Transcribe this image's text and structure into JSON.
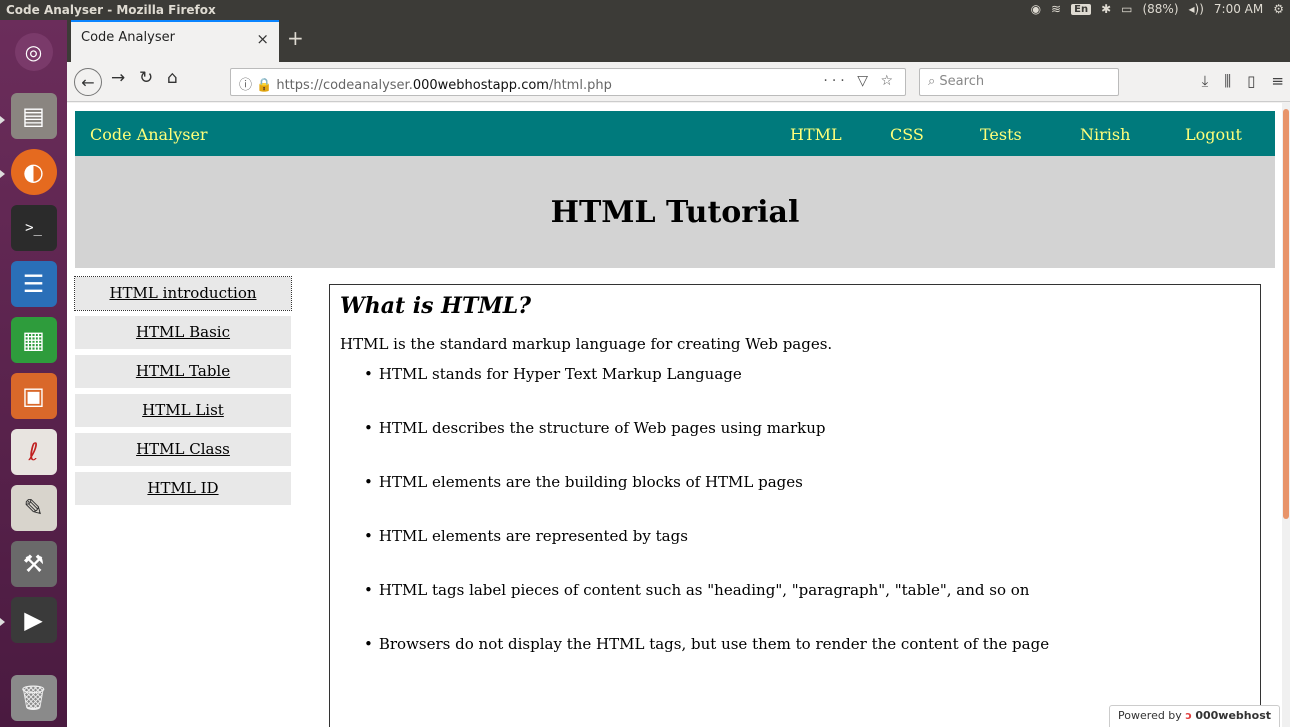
{
  "system": {
    "window_title": "Code Analyser - Mozilla Firefox",
    "keyboard_layout": "En",
    "battery": "(88%)",
    "clock": "7:00 AM"
  },
  "launcher": {
    "items": [
      {
        "name": "ubuntu-dash-icon"
      },
      {
        "name": "files-icon"
      },
      {
        "name": "firefox-icon"
      },
      {
        "name": "terminal-icon"
      },
      {
        "name": "writer-icon"
      },
      {
        "name": "calc-icon"
      },
      {
        "name": "impress-icon"
      },
      {
        "name": "document-viewer-icon"
      },
      {
        "name": "text-editor-icon"
      },
      {
        "name": "system-settings-icon"
      },
      {
        "name": "video-editor-icon"
      },
      {
        "name": "trash-icon"
      }
    ]
  },
  "browser": {
    "tab_title": "Code Analyser",
    "url_prefix": "https://codeanalyser.",
    "url_domain": "000webhostapp.com",
    "url_path": "/html.php",
    "search_placeholder": "Search"
  },
  "site": {
    "brand": "Code Analyser",
    "nav": [
      "HTML",
      "CSS",
      "Tests",
      "Nirish",
      "Logout"
    ],
    "header_title": "HTML Tutorial",
    "menu": [
      "HTML introduction",
      "HTML Basic",
      "HTML Table",
      "HTML List",
      "HTML Class",
      "HTML ID"
    ],
    "content": {
      "heading": "What is HTML?",
      "intro": "HTML is the standard markup language for creating Web pages.",
      "bullets": [
        "HTML stands for Hyper Text Markup Language",
        "HTML describes the structure of Web pages using markup",
        "HTML elements are the building blocks of HTML pages",
        "HTML elements are represented by tags",
        "HTML tags label pieces of content such as \"heading\", \"paragraph\", \"table\", and so on",
        "Browsers do not display the HTML tags, but use them to render the content of the page"
      ]
    },
    "badge_prefix": "Powered by",
    "badge_brand": "000webhost"
  },
  "colors": {
    "nav_bg": "#007a7c",
    "nav_text": "#ffff7a",
    "header_bg": "#d3d3d3",
    "launcher_bg": "#5e2750"
  }
}
